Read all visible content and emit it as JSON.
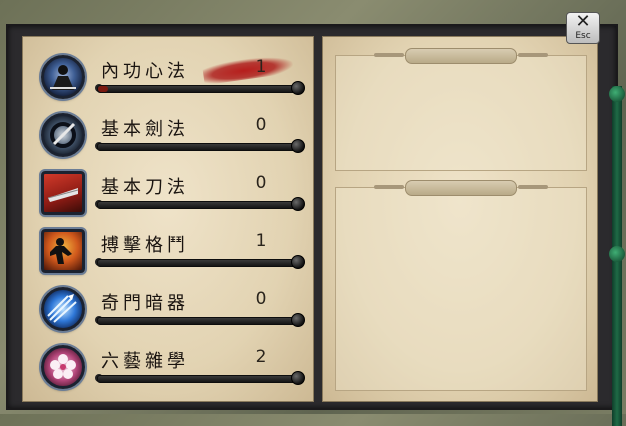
{
  "close_button": {
    "icon": "close-icon",
    "label": "Esc"
  },
  "skills": [
    {
      "name": "內功心法",
      "level": "1",
      "progress": 0.05,
      "icon": "meditation-icon",
      "highlight": true
    },
    {
      "name": "基本劍法",
      "level": "0",
      "progress": 0,
      "icon": "sword-slash-icon",
      "highlight": false
    },
    {
      "name": "基本刀法",
      "level": "0",
      "progress": 0,
      "icon": "blade-icon",
      "highlight": false
    },
    {
      "name": "搏擊格鬥",
      "level": "1",
      "progress": 0,
      "icon": "martial-arts-icon",
      "highlight": false
    },
    {
      "name": "奇門暗器",
      "level": "0",
      "progress": 0,
      "icon": "hidden-weapon-icon",
      "highlight": false
    },
    {
      "name": "六藝雜學",
      "level": "2",
      "progress": 0,
      "icon": "flower-icon",
      "highlight": false
    }
  ],
  "colors": {
    "bar_fill": "#7a1a10",
    "ink": "#1a1410",
    "icon_ring": "#6b7d96"
  }
}
